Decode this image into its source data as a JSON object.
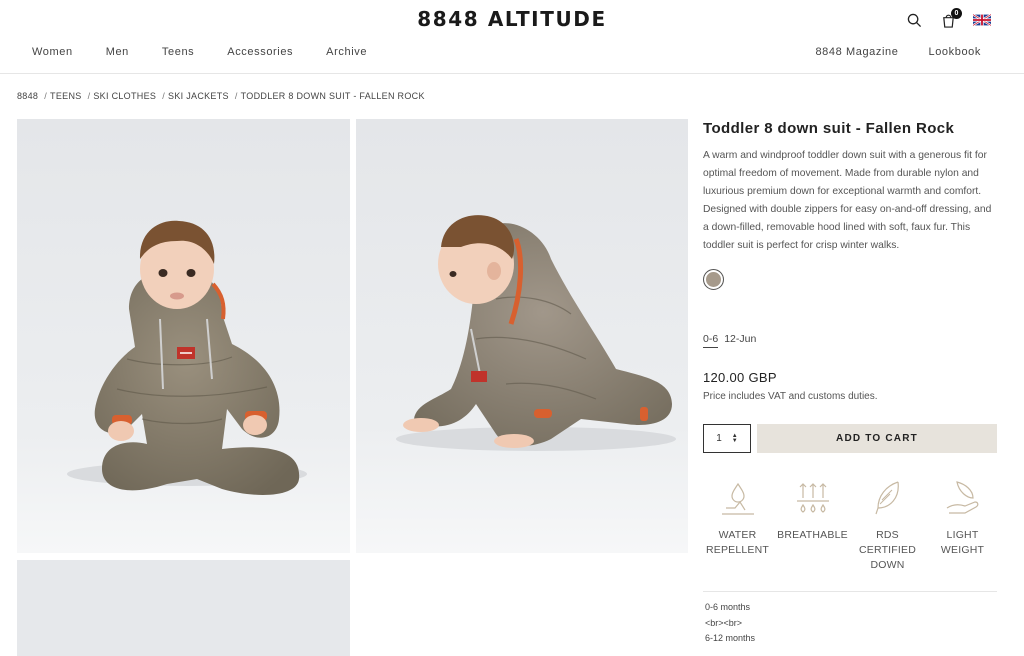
{
  "header": {
    "logo": "8848 ALTITUDE",
    "cart_count": "0",
    "nav_left": [
      "Women",
      "Men",
      "Teens",
      "Accessories",
      "Archive"
    ],
    "nav_right": [
      "8848 Magazine",
      "Lookbook"
    ]
  },
  "breadcrumb": [
    "8848",
    "TEENS",
    "SKI CLOTHES",
    "SKI JACKETS",
    "TODDLER 8 DOWN SUIT - FALLEN ROCK"
  ],
  "product": {
    "title": "Toddler 8 down suit - Fallen Rock",
    "description": "A warm and windproof toddler down suit with a generous fit for optimal freedom of movement. Made from durable nylon and luxurious premium down for exceptional warmth and comfort. Designed with double zippers for easy on-and-off dressing, and a down-filled, removable hood lined with soft, faux fur. This toddler suit is perfect for crisp winter walks.",
    "swatch_color": "#a69a8b",
    "sizes": [
      "0-6",
      "12-Jun"
    ],
    "selected_size": "0-6",
    "price": "120.00 GBP",
    "vat_note": "Price includes VAT and customs duties.",
    "quantity": "1",
    "add_to_cart": "ADD TO CART"
  },
  "features": [
    {
      "icon": "water-drop-icon",
      "label": "WATER\nREPELLENT"
    },
    {
      "icon": "breathable-icon",
      "label": "BREATHABLE"
    },
    {
      "icon": "feather-icon",
      "label": "RDS\nCERTIFIED\nDOWN"
    },
    {
      "icon": "hand-feather-icon",
      "label": "LIGHT\nWEIGHT"
    }
  ],
  "size_notes": [
    "0-6 months",
    "<br><br>",
    "6-12 months"
  ],
  "colors": {
    "suit": "#8a806f",
    "accent": "#d8602f",
    "background": "#e9eaec",
    "button": "#e7e3dc"
  }
}
